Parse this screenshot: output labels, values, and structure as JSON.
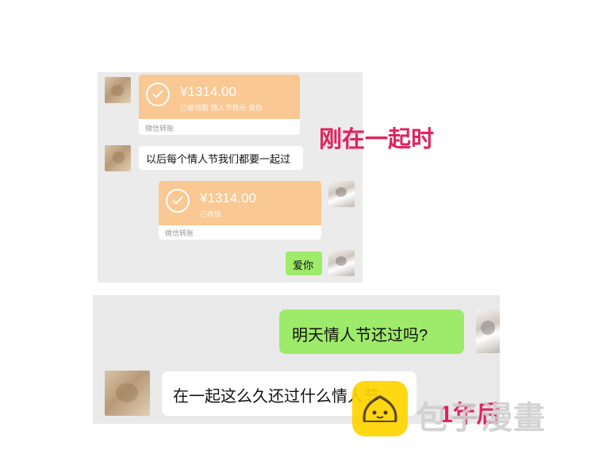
{
  "panel1": {
    "transfer1": {
      "amount": "¥1314.00",
      "status": "已被领取 情人节快乐 爱你",
      "footer": "微信转账"
    },
    "message1": "以后每个情人节我们都要一起过",
    "transfer2": {
      "amount": "¥1314.00",
      "status": "已收钱",
      "footer": "微信转账"
    },
    "message2": "爱你"
  },
  "annotation1": "刚在一起时",
  "panel2": {
    "message1": "明天情人节还过吗?",
    "message2": "在一起这么久还过什么情人节"
  },
  "annotation2": "1年后",
  "watermark": "包子漫畫",
  "colors": {
    "accent": "#e0245e",
    "transfer": "#f9c893",
    "green_bubble": "#9eea6a",
    "watermark_logo": "#ffd400"
  },
  "icons": [
    "check-circle-icon",
    "bun-mascot-icon"
  ]
}
